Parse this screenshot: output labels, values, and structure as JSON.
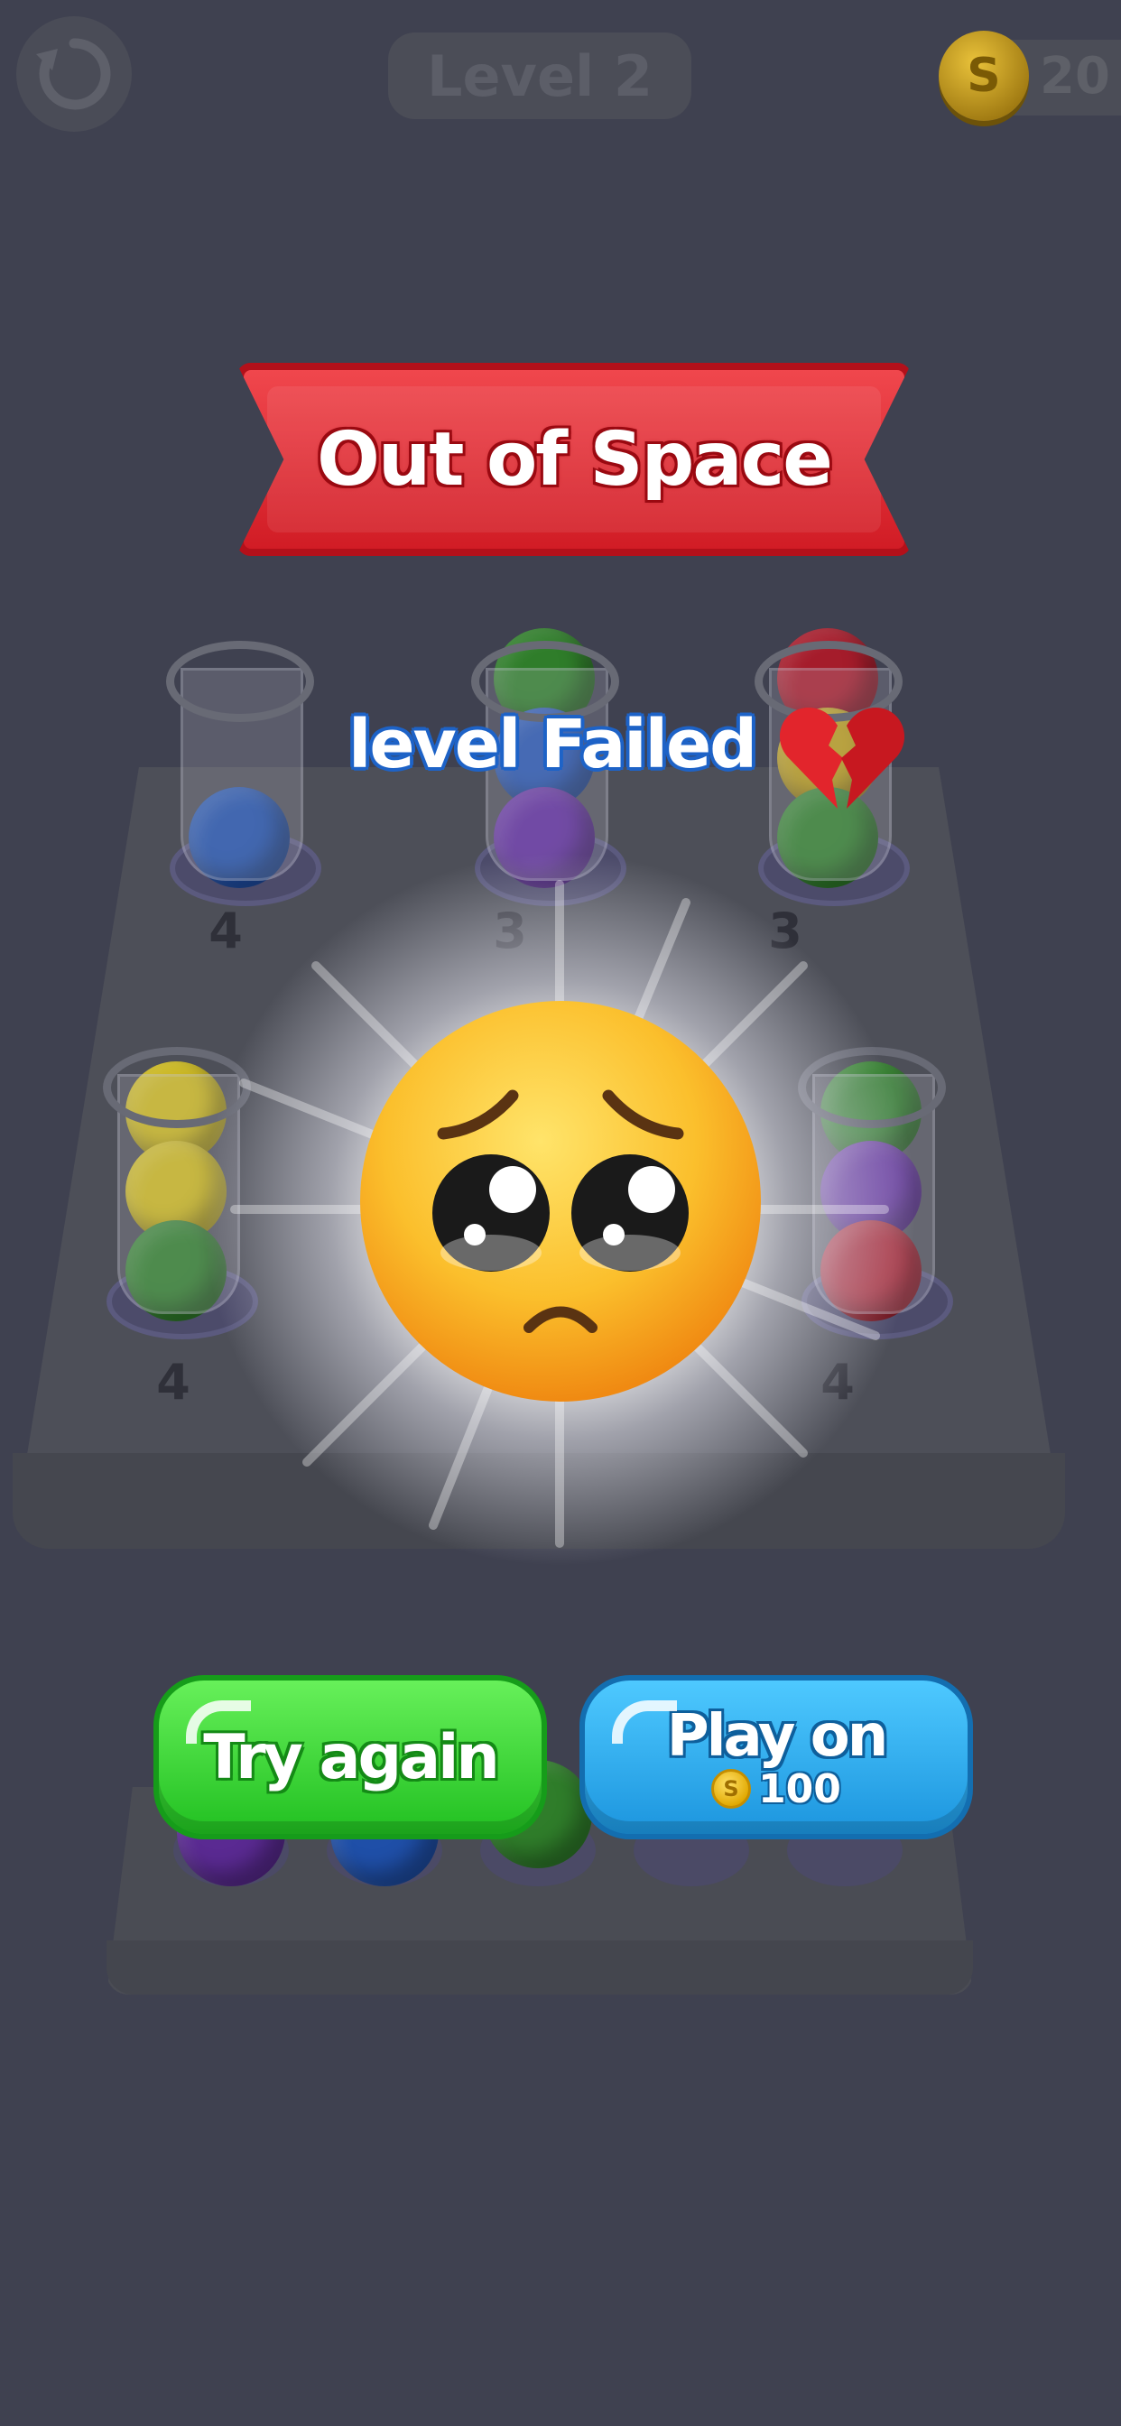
{
  "hud": {
    "level_label": "Level 2",
    "coins": "20",
    "restart_icon": "restart-icon",
    "coin_icon": "coin-icon",
    "coin_symbol": "S"
  },
  "popup": {
    "banner_title": "Out of Space",
    "status_text": "level Failed",
    "status_emoji": "💔",
    "face_emoji": "pleading-face"
  },
  "tubes": [
    {
      "count": "4",
      "balls": [
        "#1f4fa8"
      ]
    },
    {
      "count": "3",
      "balls": [
        "#2f7d2a",
        "#2553ad",
        "#5c2a9a"
      ]
    },
    {
      "count": "3",
      "balls": [
        "#a51c2b",
        "#b79a1a",
        "#2f7d2a"
      ]
    },
    {
      "count": "4",
      "balls": [
        "#c9b51b",
        "#c9b51b",
        "#2f7d2a"
      ]
    },
    {
      "count": "4",
      "balls": [
        "#2f7d2a",
        "#5c2a9a",
        "#a51c2b"
      ]
    }
  ],
  "tray_balls": [
    "#5a2a92",
    "#1f4fa8",
    "#2f7d2a",
    "",
    ""
  ],
  "buttons": {
    "try_again_label": "Try again",
    "play_on_label": "Play on",
    "play_on_cost": "100",
    "cost_coin_symbol": "S"
  },
  "colors": {
    "background": "#3f4150",
    "banner_red": "#e22b33",
    "button_green": "#36d431",
    "button_blue": "#2aa8ee"
  }
}
